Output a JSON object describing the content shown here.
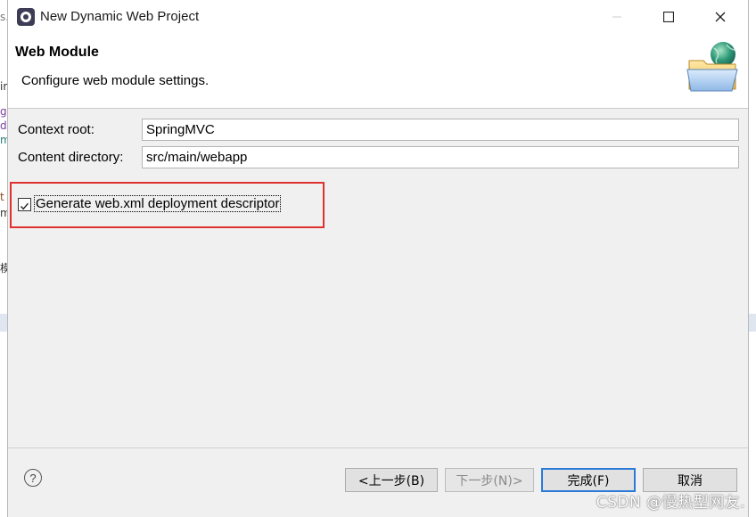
{
  "window": {
    "title": "New Dynamic Web Project"
  },
  "header": {
    "title": "Web Module",
    "description": "Configure web module settings."
  },
  "fields": {
    "context_root_label": "Context root:",
    "context_root_value": "SpringMVC",
    "content_dir_label": "Content directory:",
    "content_dir_value": "src/main/webapp"
  },
  "options": {
    "generate_descriptor_label": "Generate web.xml deployment descriptor",
    "generate_descriptor_checked": true
  },
  "footer": {
    "help_glyph": "?",
    "back_label": "<上一步(B)",
    "next_label": "下一步(N)>",
    "finish_label": "完成(F)",
    "cancel_label": "取消"
  },
  "watermark": "CSDN @慢热型网友.",
  "background_fragments": [
    "s.",
    "ir",
    "g",
    "di",
    "m",
    "t",
    "me",
    "模"
  ],
  "colors": {
    "highlight": "#e03131",
    "default_button_border": "#2b7bd8"
  }
}
